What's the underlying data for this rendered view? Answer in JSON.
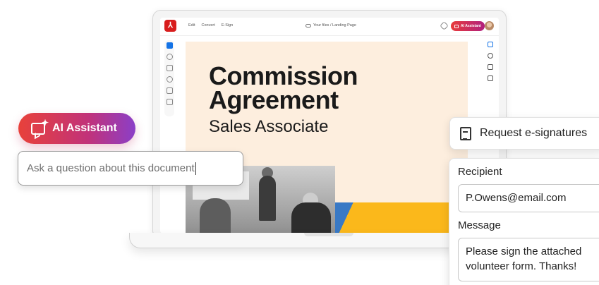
{
  "app": {
    "menu": [
      "Edit",
      "Convert",
      "E-Sign"
    ],
    "breadcrumb": "Your files / Landing Page",
    "ai_button_label": "AI Assistant"
  },
  "document": {
    "title_line1": "Commission",
    "title_line2": "Agreement",
    "subtitle": "Sales Associate"
  },
  "ai_assistant": {
    "label": "AI Assistant",
    "input_placeholder": "Ask a question about this document"
  },
  "esign": {
    "button_label": "Request e-signatures",
    "recipient_label": "Recipient",
    "recipient_value": "P.Owens@email.com",
    "message_label": "Message",
    "message_value": "Please sign the attached volunteer form. Thanks!"
  },
  "colors": {
    "accent_red": "#e8413a",
    "accent_purple": "#8b3fc8",
    "doc_background": "#fdeede",
    "doc_yellow": "#fbb81b",
    "doc_blue": "#3979c5",
    "active_tool": "#1473e6"
  }
}
